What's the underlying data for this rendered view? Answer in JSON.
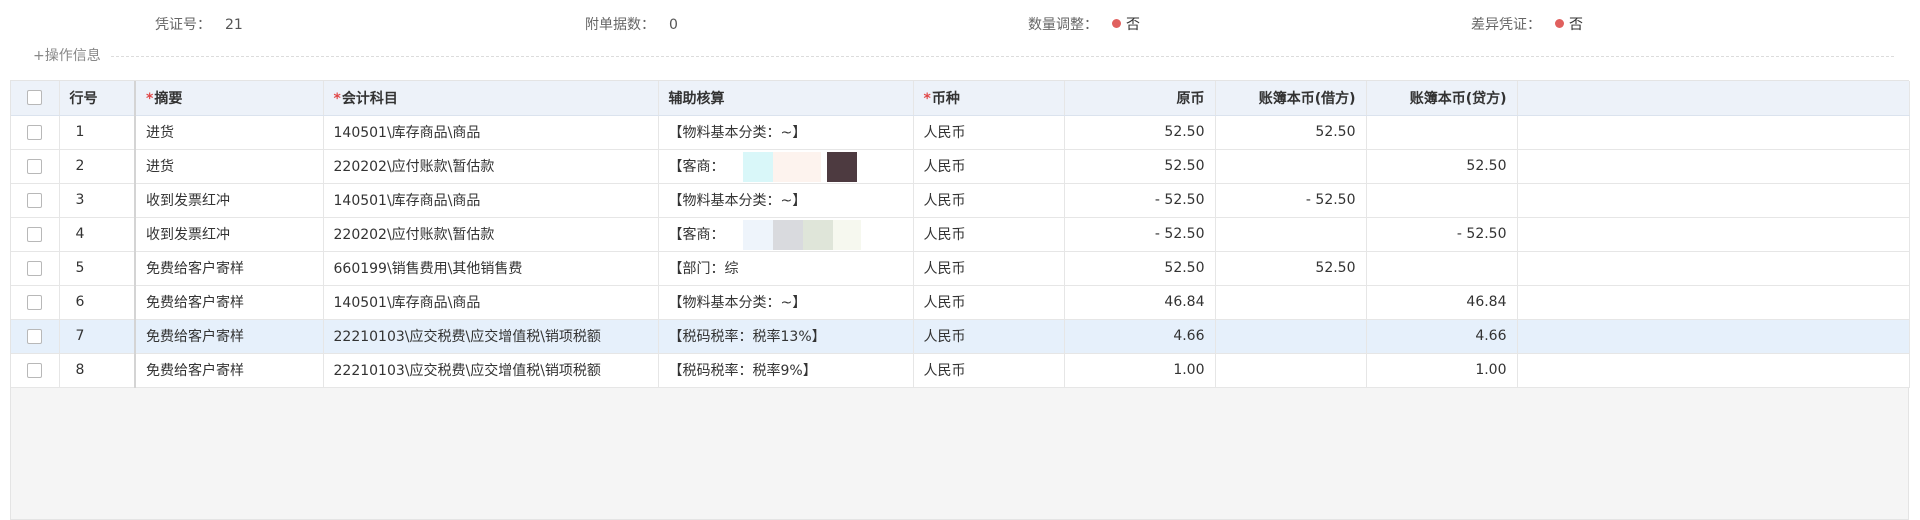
{
  "info": {
    "voucher_no_label": "凭证号：",
    "voucher_no": "21",
    "attach_label": "附单据数：",
    "attach_value": "0",
    "qty_adjust_label": "数量调整：",
    "qty_adjust_value": "否",
    "diff_voucher_label": "差异凭证：",
    "diff_voucher_value": "否",
    "status_dot_color": "#e0605e"
  },
  "ops": {
    "label": "+操作信息"
  },
  "table": {
    "headers": {
      "seq": "行号",
      "summary": "摘要",
      "account": "会计科目",
      "aux": "辅助核算",
      "currency": "币种",
      "orig": "原币",
      "debit": "账簿本币(借方)",
      "credit": "账簿本币(贷方)"
    },
    "required_mark": "*",
    "rows": [
      {
        "seq": "1",
        "summary": "进货",
        "account": "140501\\库存商品\\商品",
        "aux": "【物料基本分类：~】",
        "currency": "人民币",
        "orig": "52.50",
        "debit": "52.50",
        "credit": ""
      },
      {
        "seq": "2",
        "summary": "进货",
        "account": "220202\\应付账款\\暂估款",
        "aux": "【客商：",
        "currency": "人民币",
        "orig": "52.50",
        "debit": "",
        "credit": "52.50"
      },
      {
        "seq": "3",
        "summary": "收到发票红冲",
        "account": "140501\\库存商品\\商品",
        "aux": "【物料基本分类：~】",
        "currency": "人民币",
        "orig": "- 52.50",
        "debit": "- 52.50",
        "credit": ""
      },
      {
        "seq": "4",
        "summary": "收到发票红冲",
        "account": "220202\\应付账款\\暂估款",
        "aux": "【客商：",
        "currency": "人民币",
        "orig": "- 52.50",
        "debit": "",
        "credit": "- 52.50"
      },
      {
        "seq": "5",
        "summary": "免费给客户寄样",
        "account": "660199\\销售费用\\其他销售费",
        "aux": "【部门：综",
        "currency": "人民币",
        "orig": "52.50",
        "debit": "52.50",
        "credit": ""
      },
      {
        "seq": "6",
        "summary": "免费给客户寄样",
        "account": "140501\\库存商品\\商品",
        "aux": "【物料基本分类：~】",
        "currency": "人民币",
        "orig": "46.84",
        "debit": "",
        "credit": "46.84"
      },
      {
        "seq": "7",
        "summary": "免费给客户寄样",
        "account": "22210103\\应交税费\\应交增值税\\销项税额",
        "aux": "【税码税率：税率13%】",
        "currency": "人民币",
        "orig": "4.66",
        "debit": "",
        "credit": "4.66"
      },
      {
        "seq": "8",
        "summary": "免费给客户寄样",
        "account": "22210103\\应交税费\\应交增值税\\销项税额",
        "aux": "【税码税率：税率9%】",
        "currency": "人民币",
        "orig": "1.00",
        "debit": "",
        "credit": "1.00"
      }
    ]
  }
}
